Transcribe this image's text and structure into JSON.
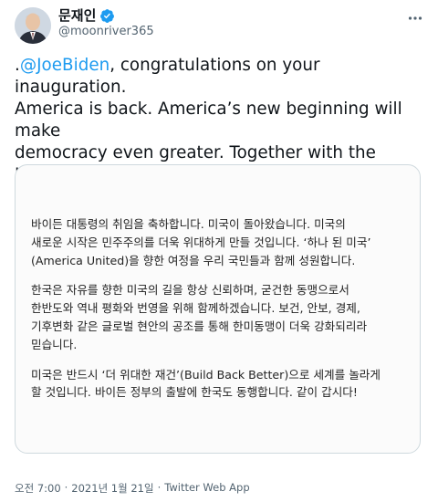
{
  "author": {
    "name": "문재인",
    "handle": "@moonriver365"
  },
  "tweet": {
    "mention": "@JoeBiden",
    "prefix": ".",
    "text": ", congratulations on your inauguration.\nAmerica is back. America’s new beginning will make\ndemocracy even greater. Together with the Korean\npeople, I stand by your journey toward ‘America\nUnited’."
  },
  "letter": {
    "paragraphs": [
      "바이든 대통령의 취임을 축하합니다. 미국이 돌아왔습니다. 미국의\n새로운 시작은 민주주의를 더욱 위대하게 만들 것입니다. ‘하나 된 미국’\n(America United)을 향한 여정을 우리 국민들과 함께 성원합니다.",
      "한국은 자유를 향한 미국의 길을 항상 신뢰하며, 굳건한 동맹으로서\n한반도와 역내 평화와 번영을 위해 함께하겠습니다. 보건, 안보, 경제,\n기후변화 같은 글로벌 현안의 공조를 통해 한미동맹이 더욱 강화되리라\n믿습니다.",
      "미국은 반드시 ‘더 위대한 재건’(Build Back Better)으로 세계를 놀라게\n할 것입니다. 바이든 정부의 출발에 한국도 동행합니다. 같이 갑시다!"
    ]
  },
  "meta": {
    "time": "오전 7:00",
    "sep1": "·",
    "date": "2021년 1월 21일",
    "sep2": "·",
    "source": "Twitter Web App"
  },
  "colors": {
    "accent": "#1d9bf0",
    "secondary_text": "#536471"
  }
}
